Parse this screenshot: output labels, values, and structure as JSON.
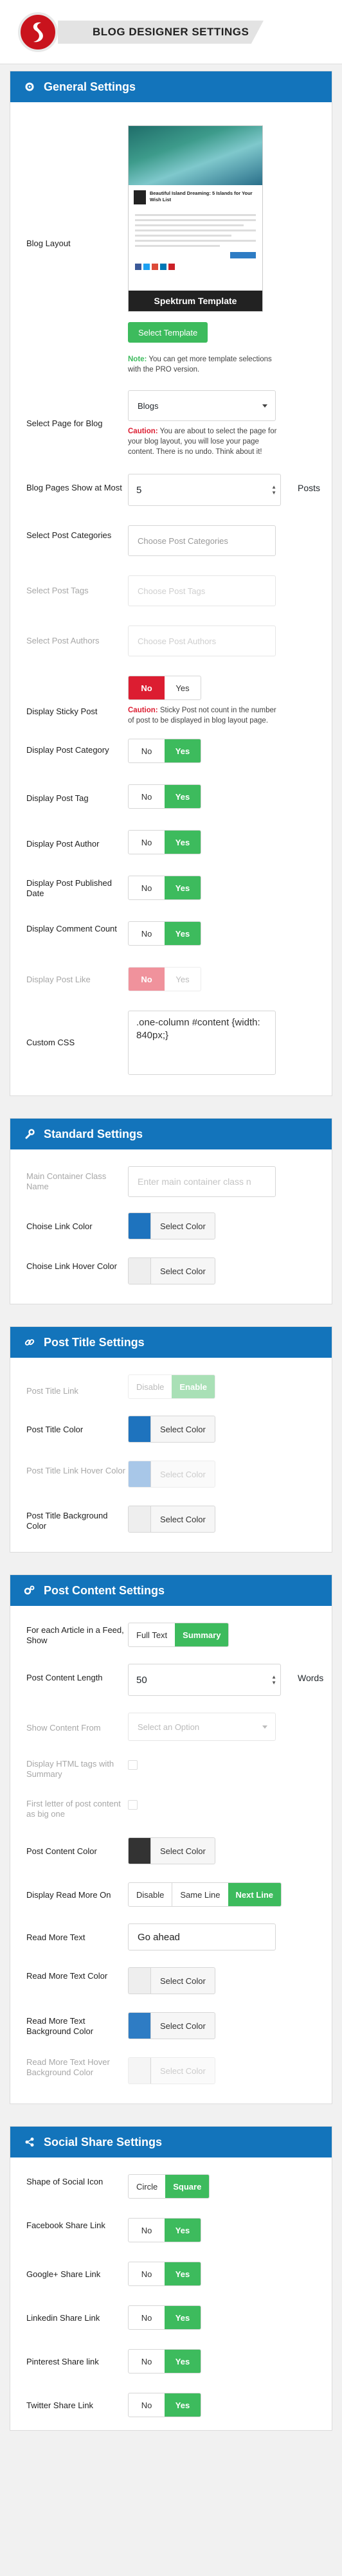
{
  "header": {
    "title": "BLOG DESIGNER SETTINGS"
  },
  "colors": {
    "accent": "#1374bb",
    "green": "#3dbb5d",
    "red": "#dc1d31"
  },
  "general": {
    "title": "General Settings",
    "blog_layout_label": "Blog Layout",
    "preview": {
      "post_title": "Beautiful Island Dreaming: 5 Islands for Your Wish List",
      "template_name": "Spektrum Template"
    },
    "select_template_btn": "Select Template",
    "note_prefix": "Note:",
    "note_text": " You can get more template selections with the PRO version.",
    "page_label": "Select Page for Blog",
    "page_value": "Blogs",
    "caution1_prefix": "Caution:",
    "caution1_text": " You are about to select the page for your blog layout, you will lose your page content. There is no undo. Think about it!",
    "pages_show_label": "Blog Pages Show at Most",
    "pages_show_value": "5",
    "pages_show_suffix": "Posts",
    "categories_label": "Select Post Categories",
    "categories_placeholder": "Choose Post Categories",
    "tags_label": "Select Post Tags",
    "tags_placeholder": "Choose Post Tags",
    "authors_label": "Select Post Authors",
    "authors_placeholder": "Choose Post Authors",
    "sticky_label": "Display Sticky Post",
    "caution2_prefix": "Caution:",
    "caution2_text": " Sticky Post not count in the number of post to be displayed in blog layout page.",
    "post_category_label": "Display Post Category",
    "post_tag_label": "Display Post Tag",
    "post_author_label": "Display Post Author",
    "post_date_label": "Display Post Published Date",
    "comment_count_label": "Display Comment Count",
    "post_like_label": "Display Post Like",
    "custom_css_label": "Custom CSS",
    "custom_css_value": ".one-column #content {width: 840px;}",
    "no": "No",
    "yes": "Yes"
  },
  "standard": {
    "title": "Standard Settings",
    "main_container_label": "Main Container Class Name",
    "main_container_placeholder": "Enter main container class n",
    "link_color_label": "Choise Link Color",
    "link_hover_label": "Choise Link Hover Color",
    "select_color": "Select Color",
    "link_color": "#1e73be",
    "link_hover_color": "#eeeeee"
  },
  "post_title": {
    "title": "Post Title Settings",
    "link_label": "Post Title Link",
    "disable": "Disable",
    "enable": "Enable",
    "color_label": "Post Title Color",
    "hover_label": "Post Title Link Hover Color",
    "bg_label": "Post Title Background Color",
    "select_color": "Select Color",
    "color": "#1e73be",
    "hover_color": "#1e73be",
    "bg_color": "#eeeeee"
  },
  "post_content": {
    "title": "Post Content Settings",
    "each_article_label": "For each Article in a Feed, Show",
    "full_text": "Full Text",
    "summary": "Summary",
    "length_label": "Post Content Length",
    "length_value": "50",
    "length_suffix": "Words",
    "show_from_label": "Show Content From",
    "show_from_placeholder": "Select an Option",
    "html_tags_label": "Display HTML tags with Summary",
    "first_letter_label": "First letter of post content as big one",
    "content_color_label": "Post Content Color",
    "read_more_on_label": "Display Read More On",
    "disable": "Disable",
    "same_line": "Same Line",
    "next_line": "Next Line",
    "read_more_text_label": "Read More Text",
    "read_more_text_value": "Go ahead",
    "read_more_color_label": "Read More Text Color",
    "read_more_bg_label": "Read More Text Background Color",
    "read_more_hover_label": "Read More Text Hover Background Color",
    "select_color": "Select Color",
    "content_color": "#333333",
    "read_more_color": "#eeeeee",
    "read_more_bg": "#2e7cc4",
    "read_more_hover": "#f5f5f5"
  },
  "social": {
    "title": "Social Share Settings",
    "shape_label": "Shape of Social Icon",
    "circle": "Circle",
    "square": "Square",
    "facebook_label": "Facebook Share Link",
    "google_label": "Google+ Share Link",
    "linkedin_label": "Linkedin Share Link",
    "pinterest_label": "Pinterest Share link",
    "twitter_label": "Twitter Share Link",
    "no": "No",
    "yes": "Yes"
  }
}
